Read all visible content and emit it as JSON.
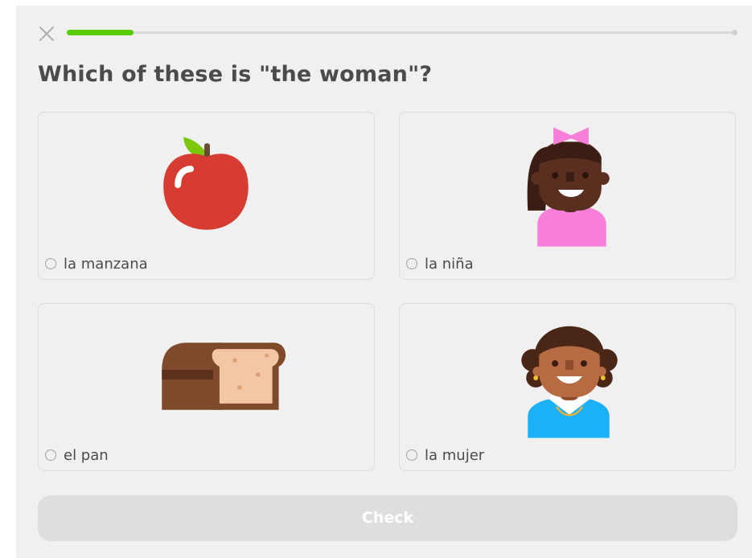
{
  "header": {
    "close_icon": "close-x-icon",
    "progress": 0.1
  },
  "question": {
    "text": "Which of these is \"the woman\"?"
  },
  "choices": [
    {
      "label": "la manzana",
      "image": "apple-illustration"
    },
    {
      "label": "la niña",
      "image": "girl-illustration"
    },
    {
      "label": "el pan",
      "image": "bread-illustration"
    },
    {
      "label": "la mujer",
      "image": "woman-illustration"
    }
  ],
  "footer": {
    "check_label": "Check"
  },
  "colors": {
    "progress": "#58cc02",
    "text": "#4b4b4b",
    "disabled_button": "#dedede"
  }
}
